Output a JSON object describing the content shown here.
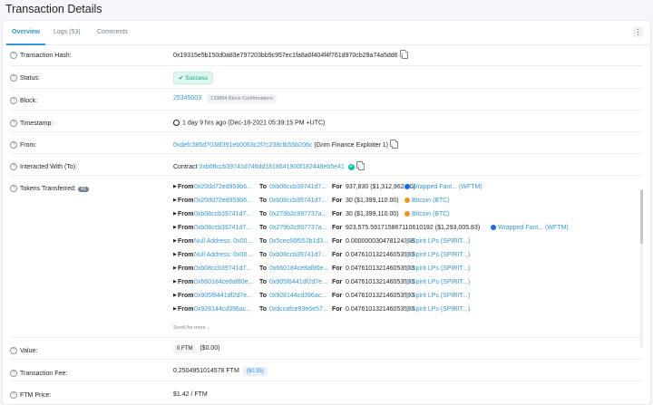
{
  "page_title": "Transaction Details",
  "tabs": [
    {
      "label": "Overview"
    },
    {
      "label": "Logs (53)"
    },
    {
      "label": "Comments"
    }
  ],
  "kebab": "⋮",
  "rows": {
    "tx_hash": {
      "label": "Transaction Hash:",
      "value": "0x19315e5b150d0a83e797203bb9c957ec1fa8a6f404f4f761d970cb29a74a5dd6"
    },
    "status": {
      "label": "Status:",
      "value": "Success"
    },
    "block": {
      "label": "Block:",
      "value": "25345003",
      "confirmations": "133854 Block Confirmations"
    },
    "timestamp": {
      "label": "Timestamp:",
      "value": "1 day 9 hrs ago (Dec-18-2021 05:39:15 PM +UTC)"
    },
    "from": {
      "label": "From:",
      "address": "0xdefc385d7038f391eb0063c2f7c238cfb55b206c",
      "name": "(Grim Finance Exploiter 1)"
    },
    "interacted": {
      "label": "Interacted With (To):",
      "prefix": "Contract",
      "address": "0xb08ccb39741d746dd1818641900f182448eb5e41"
    },
    "tokens": {
      "label": "Tokens Transferred:",
      "count": "41"
    },
    "value": {
      "label": "Value:",
      "badge": "0 FTM",
      "usd": "($0.00)"
    },
    "fee": {
      "label": "Transaction Fee:",
      "value": "0.2504951014578 FTM",
      "usd": "($0.35)"
    },
    "price": {
      "label": "FTM Price:",
      "value": "$1.42 / FTM"
    }
  },
  "token_transfers": [
    {
      "from": "0x20dd72ed959b6...",
      "to": "0xb08ccb39741d7...",
      "amount": "937,830 ($1,312,962.00)",
      "token": "Wrapped Fant... (WFTM)",
      "icon": "wftm",
      "color": "#1969ff"
    },
    {
      "from": "0x20dd72ed959b6...",
      "to": "0xb08ccb39741d7...",
      "amount": "30 ($1,399,110.00)",
      "token": "Bitcoin (BTC)",
      "icon": "btc",
      "color": "#f7931a"
    },
    {
      "from": "0xb08ccb39741d7...",
      "to": "0x279b2c897737a...",
      "amount": "30 ($1,399,110.00)",
      "token": "Bitcoin (BTC)",
      "icon": "btc",
      "color": "#f7931a"
    },
    {
      "from": "0xb08ccb39741d7...",
      "to": "0x279b2c897737a...",
      "amount": "923,575.591715867110610192 ($1,293,005.83)",
      "token": "Wrapped Fant... (WFTM)",
      "icon": "wftm",
      "color": "#1969ff"
    },
    {
      "from": "Null Address: 0x00...",
      "to": "0x5cec66f552b1d3...",
      "amount": "0.000000030478124368",
      "token": "Spirit LPs (SPIRIT...)",
      "icon": "spirit",
      "color": "#b8bcc4"
    },
    {
      "from": "Null Address: 0x00...",
      "to": "0xb08ccb39741d7...",
      "amount": "0.047610132146053993",
      "token": "Spirit LPs (SPIRIT...)",
      "icon": "spirit",
      "color": "#b8bcc4"
    },
    {
      "from": "0xb08ccb39741d7...",
      "to": "0x660184ce8af80e...",
      "amount": "0.047610132146053993",
      "token": "Spirit LPs (SPIRIT...)",
      "icon": "spirit",
      "color": "#b8bcc4"
    },
    {
      "from": "0x660184ce8af80e...",
      "to": "0x905f8441df2d7e...",
      "amount": "0.047610132146053993",
      "token": "Spirit LPs (SPIRIT...)",
      "icon": "spirit",
      "color": "#b8bcc4"
    },
    {
      "from": "0x905f8441df2d7e...",
      "to": "0x928144cd396ac...",
      "amount": "0.047610132146053993",
      "token": "Spirit LPs (SPIRIT...)",
      "icon": "spirit",
      "color": "#b8bcc4"
    },
    {
      "from": "0x928144cd396ac...",
      "to": "0xdccafce93e6e57...",
      "amount": "0.047610132146053993",
      "token": "Spirit LPs (SPIRIT...)",
      "icon": "spirit",
      "color": "#b8bcc4"
    }
  ],
  "token_labels": {
    "from": "From",
    "to": "To",
    "for": "For",
    "arrow": "▶"
  },
  "scroll_hint": "Scroll for more ↓",
  "colors": {
    "link": "#3498db",
    "success": "#00a186"
  }
}
